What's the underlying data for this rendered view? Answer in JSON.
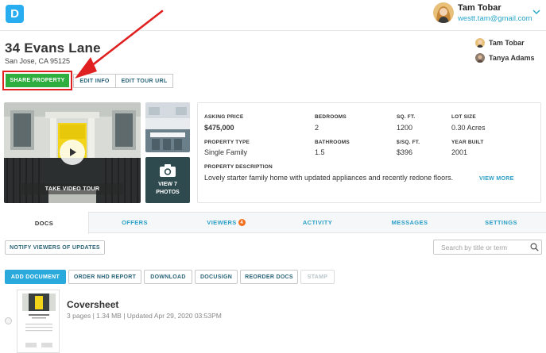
{
  "app": {
    "logo_letter": "D"
  },
  "user": {
    "name": "Tam Tobar",
    "email": "westt.tam@gmail.com"
  },
  "property": {
    "title": "34 Evans Lane",
    "address": "San Jose, CA 95125"
  },
  "collaborators": [
    {
      "name": "Tam Tobar"
    },
    {
      "name": "Tanya Adams"
    }
  ],
  "actions": {
    "share": "SHARE PROPERTY",
    "edit_info": "EDIT INFO",
    "edit_tour": "EDIT TOUR URL"
  },
  "media": {
    "tour_label": "TAKE VIDEO TOUR",
    "view_photos_line1": "VIEW 7",
    "view_photos_line2": "PHOTOS"
  },
  "details": {
    "asking_price_label": "ASKING PRICE",
    "asking_price": "$475,000",
    "bedrooms_label": "BEDROOMS",
    "bedrooms": "2",
    "sqft_label": "SQ. FT.",
    "sqft": "1200",
    "lot_size_label": "LOT SIZE",
    "lot_size": "0.30 Acres",
    "property_type_label": "PROPERTY TYPE",
    "property_type": "Single Family",
    "bathrooms_label": "BATHROOMS",
    "bathrooms": "1.5",
    "per_sqft_label": "$/SQ. FT.",
    "per_sqft": "$396",
    "year_built_label": "YEAR BUILT",
    "year_built": "2001",
    "description_label": "PROPERTY DESCRIPTION",
    "description": "Lovely starter family home with updated appliances and recently redone floors.",
    "view_more": "VIEW MORE"
  },
  "tabs": [
    {
      "label": "DOCS"
    },
    {
      "label": "OFFERS"
    },
    {
      "label": "VIEWERS",
      "badge": "4"
    },
    {
      "label": "ACTIVITY"
    },
    {
      "label": "MESSAGES"
    },
    {
      "label": "SETTINGS"
    }
  ],
  "docs_toolbar": {
    "notify": "NOTIFY VIEWERS OF UPDATES",
    "search_placeholder": "Search by title or term",
    "add_document": "ADD DOCUMENT",
    "order_nhd": "ORDER NHD REPORT",
    "download": "DOWNLOAD",
    "docusign": "DOCUSIGN",
    "reorder": "REORDER DOCS",
    "stamp": "STAMP"
  },
  "documents": [
    {
      "title": "Coversheet",
      "meta": "3 pages | 1.34 MB | Updated Apr 29, 2020 03:53PM"
    }
  ],
  "colors": {
    "accent": "#29a9dc",
    "share_green": "#2eae3e",
    "annotation_red": "#e02020",
    "badge_orange": "#f07020"
  }
}
